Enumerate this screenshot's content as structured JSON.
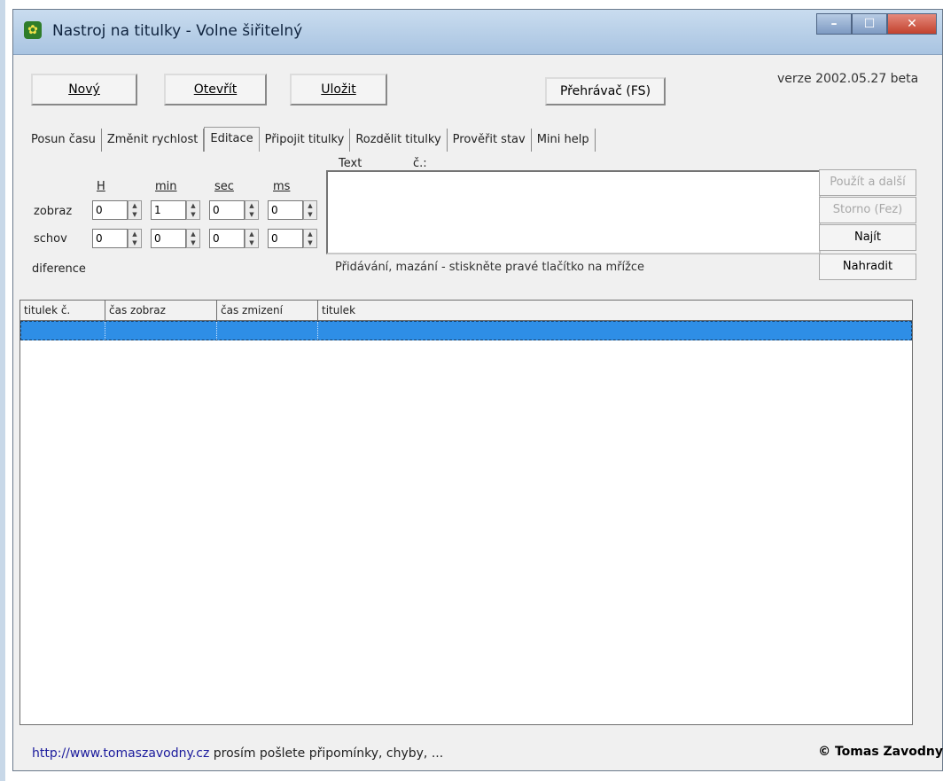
{
  "window": {
    "title": "Nastroj na titulky - Volne šiřitelný"
  },
  "toolbar": {
    "new_label": "Nový",
    "open_label": "Otevřít",
    "save_label": "Uložit",
    "preview_label": "Přehrávač (FS)"
  },
  "version": "verze 2002.05.27 beta",
  "tabs": [
    {
      "label": "Posun času",
      "active": false
    },
    {
      "label": "Změnit rychlost",
      "active": false
    },
    {
      "label": "Editace",
      "active": true
    },
    {
      "label": "Připojit titulky",
      "active": false
    },
    {
      "label": "Rozdělit titulky",
      "active": false
    },
    {
      "label": "Prověřit stav",
      "active": false
    },
    {
      "label": "Mini help",
      "active": false
    }
  ],
  "editor": {
    "headers": {
      "h": "H",
      "min": "min",
      "sec": "sec",
      "ms": "ms"
    },
    "rows": {
      "show_label": "zobraz",
      "hide_label": "schov",
      "diff_label": "diference"
    },
    "show_values": {
      "h": "0",
      "min": "1",
      "sec": "0",
      "ms": "0"
    },
    "hide_values": {
      "h": "0",
      "min": "0",
      "sec": "0",
      "ms": "0"
    },
    "text_label": "Text",
    "number_label": "č.:",
    "hint": "Přidávání, mazání - stiskněte pravé tlačítko na mřížce"
  },
  "right_buttons": {
    "apply_label": "Použít a další",
    "undo_label": "Storno (Fez)",
    "find_label": "Najít",
    "replace_label": "Nahradit"
  },
  "grid": {
    "columns": [
      "titulek č.",
      "čas zobraz",
      "čas zmizení",
      "titulek"
    ]
  },
  "status": {
    "link": "http://www.tomaszavodny.cz",
    "message": " prosím pošlete připomínky, chyby, ...",
    "copyright": "© Tomas Zavodny"
  }
}
